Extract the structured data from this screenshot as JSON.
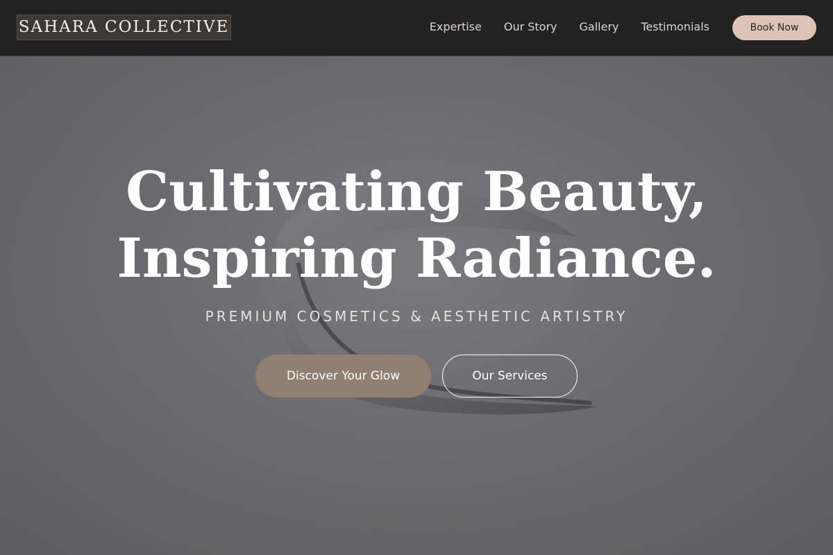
{
  "header": {
    "logo": "SAHARA COLLECTIVE",
    "nav": [
      "Expertise",
      "Our Story",
      "Gallery",
      "Testimonials"
    ],
    "book_label": "Book Now"
  },
  "hero": {
    "headline_line1": "Cultivating Beauty,",
    "headline_line2": "Inspiring Radiance.",
    "tagline": "PREMIUM COSMETICS & AESTHETIC ARTISTRY",
    "primary_cta": "Discover Your Glow",
    "secondary_cta": "Our Services"
  },
  "colors": {
    "header_bg": "#222222",
    "accent": "#dcc4b6",
    "primary_button": "#8f8073",
    "hero_overlay": "#6f6f71"
  }
}
